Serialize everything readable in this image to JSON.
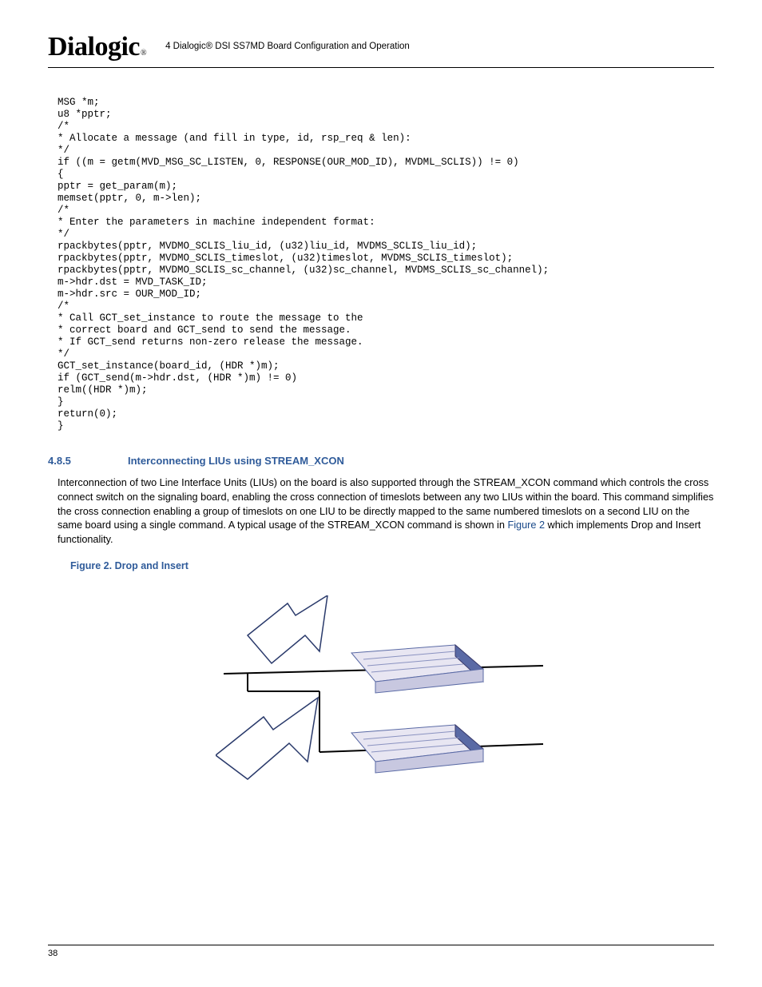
{
  "header": {
    "logo_text": "Dialogic",
    "running_title": "4 Dialogic® DSI SS7MD Board Configuration and Operation"
  },
  "code": "MSG *m;\nu8 *pptr;\n/*\n* Allocate a message (and fill in type, id, rsp_req & len):\n*/\nif ((m = getm(MVD_MSG_SC_LISTEN, 0, RESPONSE(OUR_MOD_ID), MVDML_SCLIS)) != 0)\n{\npptr = get_param(m);\nmemset(pptr, 0, m->len);\n/*\n* Enter the parameters in machine independent format:\n*/\nrpackbytes(pptr, MVDMO_SCLIS_liu_id, (u32)liu_id, MVDMS_SCLIS_liu_id);\nrpackbytes(pptr, MVDMO_SCLIS_timeslot, (u32)timeslot, MVDMS_SCLIS_timeslot);\nrpackbytes(pptr, MVDMO_SCLIS_sc_channel, (u32)sc_channel, MVDMS_SCLIS_sc_channel);\nm->hdr.dst = MVD_TASK_ID;\nm->hdr.src = OUR_MOD_ID;\n/*\n* Call GCT_set_instance to route the message to the\n* correct board and GCT_send to send the message.\n* If GCT_send returns non-zero release the message.\n*/\nGCT_set_instance(board_id, (HDR *)m);\nif (GCT_send(m->hdr.dst, (HDR *)m) != 0)\nrelm((HDR *)m);\n}\nreturn(0);\n}",
  "section": {
    "number": "4.8.5",
    "title": "Interconnecting LIUs using STREAM_XCON",
    "body_part1": "Interconnection of two Line Interface Units (LIUs) on the board is also supported through the STREAM_XCON command which controls the cross connect switch on the signaling board, enabling the cross connection of timeslots between any two LIUs within the board. This command simplifies the cross connection enabling a group of timeslots on one LIU to be directly mapped to the same numbered timeslots on a second LIU on the same board using a single command. A typical usage of the STREAM_XCON command is shown in ",
    "body_link": "Figure 2",
    "body_part2": " which implements Drop and Insert functionality."
  },
  "figure": {
    "caption": "Figure 2. Drop and Insert"
  },
  "footer": {
    "page_number": "38"
  }
}
